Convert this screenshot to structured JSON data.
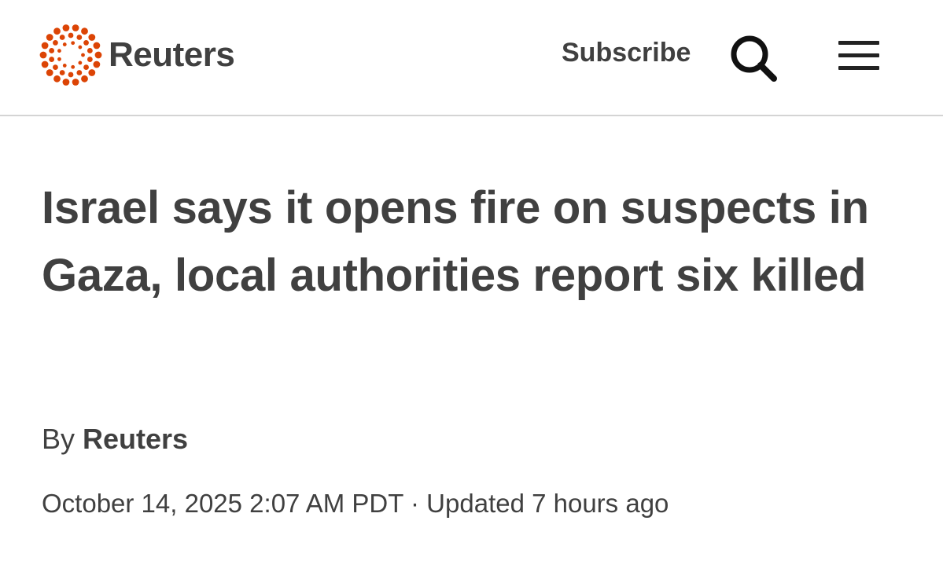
{
  "header": {
    "logo_text": "Reuters",
    "logo_icon": "reuters-dot-ring-logo",
    "subscribe_label": "Subscribe",
    "search_icon": "search-icon",
    "menu_icon": "hamburger-menu-icon",
    "brand_color": "#dc4405"
  },
  "article": {
    "headline": "Israel says it opens fire on suspects in Gaza, local authorities report six killed",
    "byline_prefix": "By",
    "byline_author": "Reuters",
    "published": "October 14, 2025 2:07 AM PDT",
    "separator": "·",
    "updated": "Updated 7 hours ago"
  }
}
